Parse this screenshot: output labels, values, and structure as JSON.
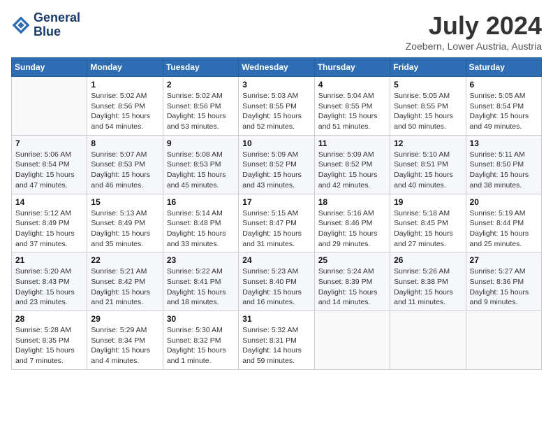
{
  "header": {
    "logo_line1": "General",
    "logo_line2": "Blue",
    "month": "July 2024",
    "location": "Zoebern, Lower Austria, Austria"
  },
  "days_of_week": [
    "Sunday",
    "Monday",
    "Tuesday",
    "Wednesday",
    "Thursday",
    "Friday",
    "Saturday"
  ],
  "weeks": [
    [
      {
        "day": "",
        "info": ""
      },
      {
        "day": "1",
        "info": "Sunrise: 5:02 AM\nSunset: 8:56 PM\nDaylight: 15 hours\nand 54 minutes."
      },
      {
        "day": "2",
        "info": "Sunrise: 5:02 AM\nSunset: 8:56 PM\nDaylight: 15 hours\nand 53 minutes."
      },
      {
        "day": "3",
        "info": "Sunrise: 5:03 AM\nSunset: 8:55 PM\nDaylight: 15 hours\nand 52 minutes."
      },
      {
        "day": "4",
        "info": "Sunrise: 5:04 AM\nSunset: 8:55 PM\nDaylight: 15 hours\nand 51 minutes."
      },
      {
        "day": "5",
        "info": "Sunrise: 5:05 AM\nSunset: 8:55 PM\nDaylight: 15 hours\nand 50 minutes."
      },
      {
        "day": "6",
        "info": "Sunrise: 5:05 AM\nSunset: 8:54 PM\nDaylight: 15 hours\nand 49 minutes."
      }
    ],
    [
      {
        "day": "7",
        "info": "Sunrise: 5:06 AM\nSunset: 8:54 PM\nDaylight: 15 hours\nand 47 minutes."
      },
      {
        "day": "8",
        "info": "Sunrise: 5:07 AM\nSunset: 8:53 PM\nDaylight: 15 hours\nand 46 minutes."
      },
      {
        "day": "9",
        "info": "Sunrise: 5:08 AM\nSunset: 8:53 PM\nDaylight: 15 hours\nand 45 minutes."
      },
      {
        "day": "10",
        "info": "Sunrise: 5:09 AM\nSunset: 8:52 PM\nDaylight: 15 hours\nand 43 minutes."
      },
      {
        "day": "11",
        "info": "Sunrise: 5:09 AM\nSunset: 8:52 PM\nDaylight: 15 hours\nand 42 minutes."
      },
      {
        "day": "12",
        "info": "Sunrise: 5:10 AM\nSunset: 8:51 PM\nDaylight: 15 hours\nand 40 minutes."
      },
      {
        "day": "13",
        "info": "Sunrise: 5:11 AM\nSunset: 8:50 PM\nDaylight: 15 hours\nand 38 minutes."
      }
    ],
    [
      {
        "day": "14",
        "info": "Sunrise: 5:12 AM\nSunset: 8:49 PM\nDaylight: 15 hours\nand 37 minutes."
      },
      {
        "day": "15",
        "info": "Sunrise: 5:13 AM\nSunset: 8:49 PM\nDaylight: 15 hours\nand 35 minutes."
      },
      {
        "day": "16",
        "info": "Sunrise: 5:14 AM\nSunset: 8:48 PM\nDaylight: 15 hours\nand 33 minutes."
      },
      {
        "day": "17",
        "info": "Sunrise: 5:15 AM\nSunset: 8:47 PM\nDaylight: 15 hours\nand 31 minutes."
      },
      {
        "day": "18",
        "info": "Sunrise: 5:16 AM\nSunset: 8:46 PM\nDaylight: 15 hours\nand 29 minutes."
      },
      {
        "day": "19",
        "info": "Sunrise: 5:18 AM\nSunset: 8:45 PM\nDaylight: 15 hours\nand 27 minutes."
      },
      {
        "day": "20",
        "info": "Sunrise: 5:19 AM\nSunset: 8:44 PM\nDaylight: 15 hours\nand 25 minutes."
      }
    ],
    [
      {
        "day": "21",
        "info": "Sunrise: 5:20 AM\nSunset: 8:43 PM\nDaylight: 15 hours\nand 23 minutes."
      },
      {
        "day": "22",
        "info": "Sunrise: 5:21 AM\nSunset: 8:42 PM\nDaylight: 15 hours\nand 21 minutes."
      },
      {
        "day": "23",
        "info": "Sunrise: 5:22 AM\nSunset: 8:41 PM\nDaylight: 15 hours\nand 18 minutes."
      },
      {
        "day": "24",
        "info": "Sunrise: 5:23 AM\nSunset: 8:40 PM\nDaylight: 15 hours\nand 16 minutes."
      },
      {
        "day": "25",
        "info": "Sunrise: 5:24 AM\nSunset: 8:39 PM\nDaylight: 15 hours\nand 14 minutes."
      },
      {
        "day": "26",
        "info": "Sunrise: 5:26 AM\nSunset: 8:38 PM\nDaylight: 15 hours\nand 11 minutes."
      },
      {
        "day": "27",
        "info": "Sunrise: 5:27 AM\nSunset: 8:36 PM\nDaylight: 15 hours\nand 9 minutes."
      }
    ],
    [
      {
        "day": "28",
        "info": "Sunrise: 5:28 AM\nSunset: 8:35 PM\nDaylight: 15 hours\nand 7 minutes."
      },
      {
        "day": "29",
        "info": "Sunrise: 5:29 AM\nSunset: 8:34 PM\nDaylight: 15 hours\nand 4 minutes."
      },
      {
        "day": "30",
        "info": "Sunrise: 5:30 AM\nSunset: 8:32 PM\nDaylight: 15 hours\nand 1 minute."
      },
      {
        "day": "31",
        "info": "Sunrise: 5:32 AM\nSunset: 8:31 PM\nDaylight: 14 hours\nand 59 minutes."
      },
      {
        "day": "",
        "info": ""
      },
      {
        "day": "",
        "info": ""
      },
      {
        "day": "",
        "info": ""
      }
    ]
  ]
}
